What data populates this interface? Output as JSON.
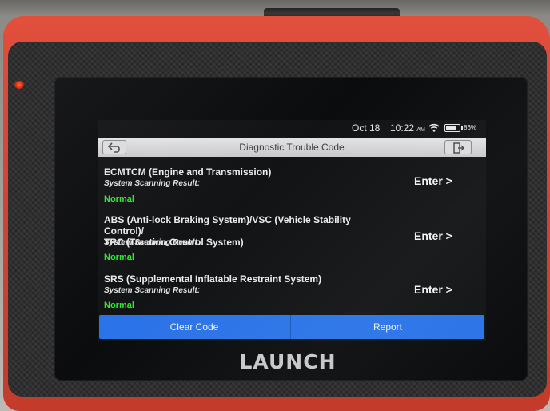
{
  "status": {
    "date": "Oct 18",
    "time": "10:22",
    "ampm": "AM",
    "battery": "86%",
    "battery_level": 0.86,
    "wifi_icon": "wifi-icon",
    "battery_icon": "battery-icon"
  },
  "header": {
    "title": "Diagnostic Trouble Code",
    "back_icon": "back-arrow-icon",
    "exit_icon": "exit-icon"
  },
  "systems": [
    {
      "name_lines": [
        "ECMTCM (Engine and Transmission)"
      ],
      "scan_label": "System Scanning Result:",
      "result": "Normal",
      "enter_label": "Enter >"
    },
    {
      "name_lines": [
        "ABS (Anti-lock Braking System)/VSC (Vehicle Stability Control)/",
        "TRC (Traction Control System)"
      ],
      "scan_label": "System Scanning Result:",
      "result": "Normal",
      "enter_label": "Enter >"
    },
    {
      "name_lines": [
        "SRS (Supplemental Inflatable Restraint System)"
      ],
      "scan_label": "System Scanning Result:",
      "result": "Normal",
      "enter_label": "Enter >"
    }
  ],
  "actions": {
    "clear_code": "Clear Code",
    "report": "Report"
  },
  "device": {
    "brand": "LAUNCH"
  },
  "colors": {
    "accent": "#2a73e8",
    "status_normal": "#2ee82e",
    "shell": "#d64432"
  }
}
